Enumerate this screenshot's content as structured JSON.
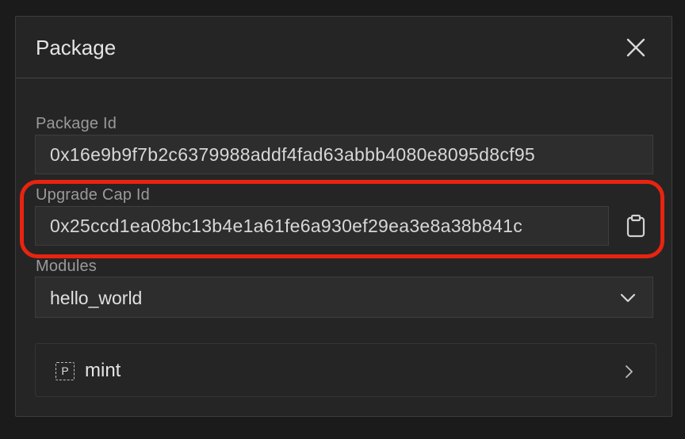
{
  "panel": {
    "title": "Package",
    "close_icon": "close-icon"
  },
  "package_id": {
    "label": "Package Id",
    "value": "0x16e9b9f7b2c6379988addf4fad63abbb4080e8095d8cf95"
  },
  "upgrade_cap": {
    "label": "Upgrade Cap Id",
    "value": "0x25ccd1ea08bc13b4e1a61fe6a930ef29ea3e8a38b841c",
    "copy_icon": "clipboard-icon",
    "highlight_color": "#e8240f"
  },
  "modules": {
    "label": "Modules",
    "selected": "hello_world",
    "dropdown_icon": "chevron-down-icon"
  },
  "function": {
    "badge": "P",
    "name": "mint",
    "chevron_icon": "chevron-right-icon"
  }
}
